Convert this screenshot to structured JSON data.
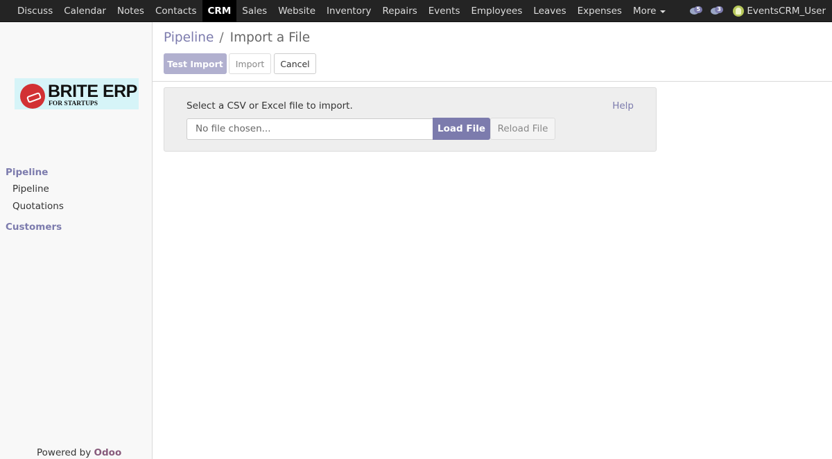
{
  "topbar": {
    "apps": [
      {
        "label": "Discuss"
      },
      {
        "label": "Calendar"
      },
      {
        "label": "Notes"
      },
      {
        "label": "Contacts"
      },
      {
        "label": "CRM",
        "active": true
      },
      {
        "label": "Sales"
      },
      {
        "label": "Website"
      },
      {
        "label": "Inventory"
      },
      {
        "label": "Repairs"
      },
      {
        "label": "Events"
      },
      {
        "label": "Employees"
      },
      {
        "label": "Leaves"
      },
      {
        "label": "Expenses"
      },
      {
        "label": "More"
      }
    ],
    "activities_count": "5",
    "messages_count": "3",
    "user_name": "EventsCRM_User"
  },
  "sidebar": {
    "logo": {
      "brand": "BRITE ERP",
      "tagline": "FOR STARTUPS"
    },
    "sections": [
      {
        "label": "Pipeline",
        "items": [
          {
            "label": "Pipeline"
          },
          {
            "label": "Quotations"
          }
        ]
      },
      {
        "label": "Customers",
        "items": []
      }
    ],
    "powered_by": "Powered by",
    "powered_brand": "Odoo"
  },
  "breadcrumb": {
    "parent": "Pipeline",
    "separator": "/",
    "current": "Import a File"
  },
  "buttons": {
    "test_import": "Test Import",
    "import": "Import",
    "cancel": "Cancel"
  },
  "import_panel": {
    "prompt": "Select a CSV or Excel file to import.",
    "help": "Help",
    "file_placeholder": "No file chosen...",
    "load_file": "Load File",
    "reload_file": "Reload File"
  },
  "colors": {
    "accent": "#7c7bad",
    "topbar": "#242424",
    "odoo_brand": "#875a7b"
  }
}
